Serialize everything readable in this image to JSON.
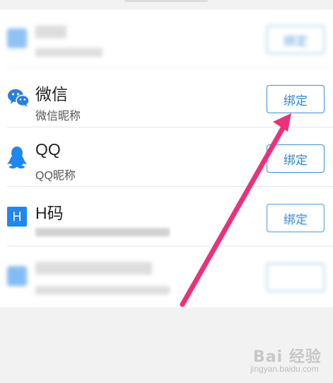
{
  "accounts": [
    {
      "title": "",
      "subtitle": "",
      "button": "绑定",
      "blurred": true
    },
    {
      "title": "微信",
      "subtitle": "微信昵称",
      "button": "绑定",
      "blurred": false
    },
    {
      "title": "QQ",
      "subtitle": "QQ昵称",
      "button": "绑定",
      "blurred": false
    },
    {
      "title": "H码",
      "subtitle": "",
      "button": "绑定",
      "blurred": false
    },
    {
      "title": "",
      "subtitle": "",
      "button": "",
      "blurred": true
    }
  ],
  "icons": {
    "row0": "blue-app-icon",
    "wechat": "wechat-icon",
    "qq": "qq-penguin-icon",
    "h": "h-code-icon",
    "h_letter": "H",
    "row4": "blue-app-icon"
  },
  "colors": {
    "accent": "#2f86d4",
    "arrow": "#ef2f7a",
    "wechat": "#2a7fe0",
    "qq": "#1e88f0"
  },
  "watermark": {
    "logo": "Bai 经验",
    "url": "jingyan.baidu.com"
  }
}
